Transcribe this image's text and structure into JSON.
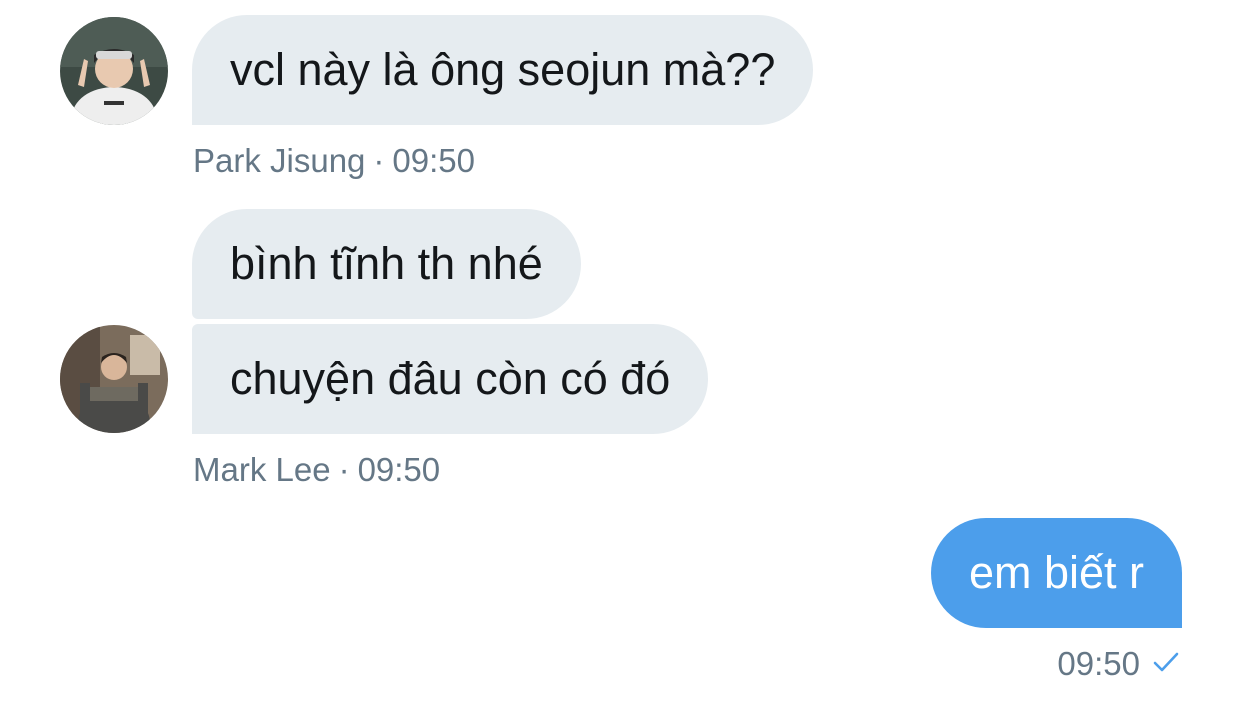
{
  "theme": {
    "incoming_bubble_color": "#e6ecf0",
    "outgoing_bubble_color": "#4c9eeb",
    "meta_text_color": "#657786"
  },
  "messages": [
    {
      "sender": "Park Jisung",
      "text": "vcl này là ông seojun mà??",
      "direction": "incoming"
    },
    {
      "sender": "Mark Lee",
      "text": "bình tĩnh th nhé",
      "direction": "incoming"
    },
    {
      "sender": "Mark Lee",
      "text": "chuyện đâu còn có đó",
      "direction": "incoming"
    },
    {
      "sender": "",
      "text": "em biết r",
      "direction": "outgoing",
      "status_icon": "single-check-icon"
    }
  ],
  "groups": [
    {
      "name": "Park Jisung",
      "time": "09:50",
      "separator": "·"
    },
    {
      "name": "Mark Lee",
      "time": "09:50",
      "separator": "·"
    },
    {
      "name": "",
      "time": "09:50",
      "separator": ""
    }
  ]
}
